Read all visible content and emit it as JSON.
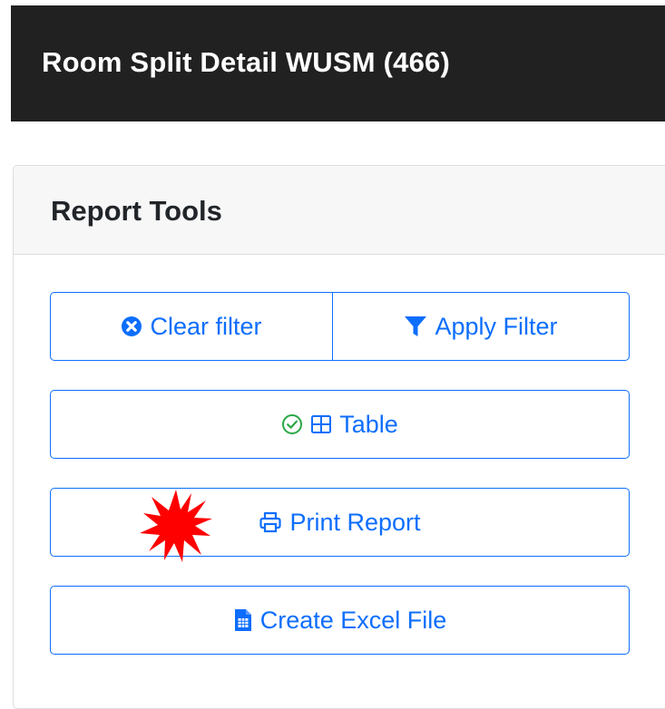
{
  "header": {
    "title": "Room Split Detail WUSM (466)"
  },
  "report_tools": {
    "title": "Report Tools",
    "clear_filter_label": "Clear filter",
    "apply_filter_label": "Apply Filter",
    "table_label": "Table",
    "print_report_label": "Print Report",
    "create_excel_label": "Create Excel File"
  },
  "icons": {
    "clear_filter": "times-circle-icon",
    "apply_filter": "filter-icon",
    "table_check": "check-circle-icon",
    "table": "table-grid-icon",
    "print": "printer-icon",
    "excel": "spreadsheet-file-icon",
    "annotation": "red-starburst-marker"
  },
  "colors": {
    "header_bg": "#212121",
    "primary": "#0d6efd",
    "success": "#28a745",
    "card_header_bg": "#f7f7f7",
    "marker": "#ff0000"
  }
}
